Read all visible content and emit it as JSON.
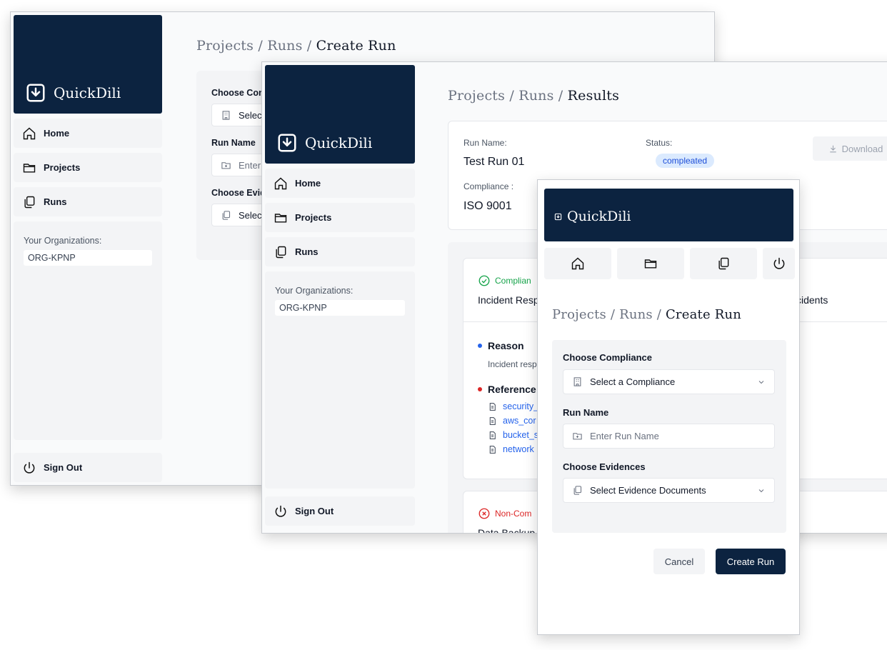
{
  "brand": "QuickDili",
  "nav": {
    "home": "Home",
    "projects": "Projects",
    "runs": "Runs",
    "sign_out": "Sign Out"
  },
  "org": {
    "label": "Your Organizations:",
    "value": "ORG-KPNP"
  },
  "breadcrumb": {
    "projects": "Projects",
    "runs": "Runs",
    "sep": "/",
    "create_run": "Create Run",
    "results": "Results"
  },
  "back_form": {
    "compliance_label": "Choose Con",
    "compliance_placeholder": "Select",
    "run_name_label": "Run Name",
    "run_name_placeholder": "Enter",
    "evidence_label": "Choose Evid",
    "evidence_placeholder": "Select"
  },
  "results": {
    "run_name_label": "Run Name:",
    "run_name_value": "Test Run 01",
    "status_label": "Status:",
    "status_value": "compleated",
    "compliance_label": "Compliance :",
    "compliance_value": "ISO 9001",
    "download": "Download",
    "item1_status": "Complian",
    "item1_title": "Incident Resp",
    "item1_title_tail": "cidents",
    "reason_label": "Reason",
    "reason_text": "Incident resp",
    "references_label": "Reference",
    "references": [
      "security_",
      "aws_cor",
      "bucket_s",
      "network"
    ],
    "item2_status": "Non-Com",
    "item2_title": "Data Backup"
  },
  "modal_form": {
    "compliance_label": "Choose Compliance",
    "compliance_placeholder": "Select a Compliance",
    "run_name_label": "Run Name",
    "run_name_placeholder": "Enter Run Name",
    "evidence_label": "Choose Evidences",
    "evidence_placeholder": "Select Evidence Documents",
    "cancel": "Cancel",
    "create": "Create Run"
  },
  "colors": {
    "brand_navy": "#0c2340",
    "success": "#16a34a",
    "danger": "#dc2626",
    "link": "#2563eb",
    "badge_bg": "#dbeafe"
  }
}
